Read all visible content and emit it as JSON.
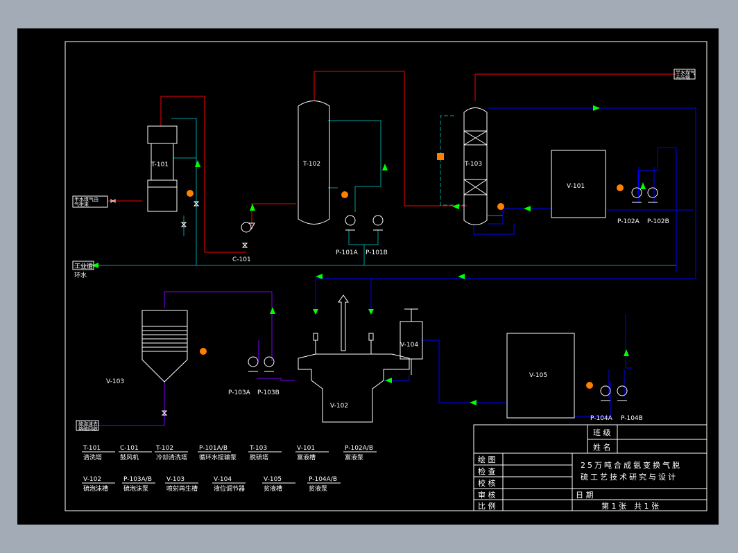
{
  "equipment": {
    "T101": "T-101",
    "T102": "T-102",
    "T103": "T-103",
    "V101": "V-101",
    "V102": "V-102",
    "V103": "V-103",
    "V104": "V-104",
    "V105": "V-105",
    "C101": "C-101",
    "P101A": "P-101A",
    "P101B": "P-101B",
    "P102A": "P-102A",
    "P102B": "P-102B",
    "P103A": "P-103A",
    "P103B": "P-103B",
    "P104A": "P-104A",
    "P104B": "P-104B"
  },
  "streams": {
    "feed_gas_in": "半水煤气由\n气柜来",
    "gas_out": "半水煤气\n去压缩",
    "cooling_water_1": "工业循",
    "cooling_water_2": "环水",
    "sulfur_out": "硫泡沫去\n熔硫回收"
  },
  "legend": [
    {
      "code": "T-101",
      "name": "清洗塔"
    },
    {
      "code": "C-101",
      "name": "鼓风机"
    },
    {
      "code": "T-102",
      "name": "冷却清洗塔"
    },
    {
      "code": "P-101A/B",
      "name": "循环水提输泵"
    },
    {
      "code": "T-103",
      "name": "脱硫塔"
    },
    {
      "code": "V-101",
      "name": "富液槽"
    },
    {
      "code": "P-102A/B",
      "name": "富液泵"
    },
    {
      "code": "V-102",
      "name": "硫泡沫槽"
    },
    {
      "code": "P-103A/B",
      "name": "硫泡沫泵"
    },
    {
      "code": "V-103",
      "name": "喷射再生槽"
    },
    {
      "code": "V-104",
      "name": "液位调节器"
    },
    {
      "code": "V-105",
      "name": "贫液槽"
    },
    {
      "code": "P-104A/B",
      "name": "贫液泵"
    }
  ],
  "title_block": {
    "class_label": "班 级",
    "name_label": "姓 名",
    "drawn": "绘 图",
    "checked": "检 查",
    "proofread": "校 核",
    "reviewed": "审 核",
    "scale": "比 例",
    "title_line1": "25万吨合成氨变换气脱",
    "title_line2": "硫工艺技术研究与设计",
    "date": "日 期",
    "sheet": "第 1 张　共 1 张"
  },
  "colors": {
    "gas_line": "#ff0000",
    "water_line": "#00a0a0",
    "solution_line": "#0000ff",
    "foam_line": "#8000ff",
    "arrow": "#00ff00",
    "equipment": "#ffffff",
    "instrument": "#ff8000"
  }
}
